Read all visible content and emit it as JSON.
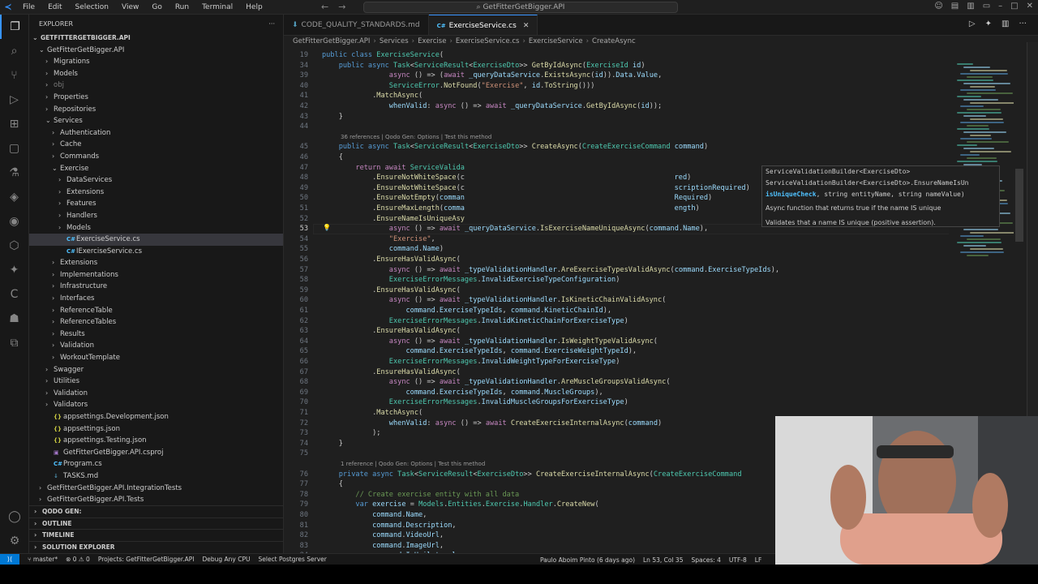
{
  "titlebar": {
    "menu": [
      "File",
      "Edit",
      "Selection",
      "View",
      "Go",
      "Run",
      "Terminal",
      "Help"
    ],
    "search": "GetFitterGetBigger.API"
  },
  "explorer": {
    "title": "EXPLORER",
    "root": "GETFITTERGETBIGGER.API",
    "tree": [
      {
        "label": "GetFitterGetBigger.API",
        "depth": 1,
        "type": "folder",
        "open": true
      },
      {
        "label": "Migrations",
        "depth": 2,
        "type": "folder"
      },
      {
        "label": "Models",
        "depth": 2,
        "type": "folder"
      },
      {
        "label": "obj",
        "depth": 2,
        "type": "folder",
        "dim": true
      },
      {
        "label": "Properties",
        "depth": 2,
        "type": "folder"
      },
      {
        "label": "Repositories",
        "depth": 2,
        "type": "folder"
      },
      {
        "label": "Services",
        "depth": 2,
        "type": "folder",
        "open": true
      },
      {
        "label": "Authentication",
        "depth": 3,
        "type": "folder"
      },
      {
        "label": "Cache",
        "depth": 3,
        "type": "folder"
      },
      {
        "label": "Commands",
        "depth": 3,
        "type": "folder"
      },
      {
        "label": "Exercise",
        "depth": 3,
        "type": "folder",
        "open": true
      },
      {
        "label": "DataServices",
        "depth": 4,
        "type": "folder"
      },
      {
        "label": "Extensions",
        "depth": 4,
        "type": "folder"
      },
      {
        "label": "Features",
        "depth": 4,
        "type": "folder"
      },
      {
        "label": "Handlers",
        "depth": 4,
        "type": "folder"
      },
      {
        "label": "Models",
        "depth": 4,
        "type": "folder"
      },
      {
        "label": "ExerciseService.cs",
        "depth": 4,
        "type": "cs",
        "selected": true
      },
      {
        "label": "IExerciseService.cs",
        "depth": 4,
        "type": "cs"
      },
      {
        "label": "Extensions",
        "depth": 3,
        "type": "folder"
      },
      {
        "label": "Implementations",
        "depth": 3,
        "type": "folder"
      },
      {
        "label": "Infrastructure",
        "depth": 3,
        "type": "folder"
      },
      {
        "label": "Interfaces",
        "depth": 3,
        "type": "folder"
      },
      {
        "label": "ReferenceTable",
        "depth": 3,
        "type": "folder"
      },
      {
        "label": "ReferenceTables",
        "depth": 3,
        "type": "folder"
      },
      {
        "label": "Results",
        "depth": 3,
        "type": "folder"
      },
      {
        "label": "Validation",
        "depth": 3,
        "type": "folder"
      },
      {
        "label": "WorkoutTemplate",
        "depth": 3,
        "type": "folder"
      },
      {
        "label": "Swagger",
        "depth": 2,
        "type": "folder"
      },
      {
        "label": "Utilities",
        "depth": 2,
        "type": "folder"
      },
      {
        "label": "Validation",
        "depth": 2,
        "type": "folder"
      },
      {
        "label": "Validators",
        "depth": 2,
        "type": "folder"
      },
      {
        "label": "appsettings.Development.json",
        "depth": 2,
        "type": "json"
      },
      {
        "label": "appsettings.json",
        "depth": 2,
        "type": "json"
      },
      {
        "label": "appsettings.Testing.json",
        "depth": 2,
        "type": "json"
      },
      {
        "label": "GetFitterGetBigger.API.csproj",
        "depth": 2,
        "type": "proj"
      },
      {
        "label": "Program.cs",
        "depth": 2,
        "type": "cs"
      },
      {
        "label": "TASKS.md",
        "depth": 2,
        "type": "md"
      },
      {
        "label": "GetFitterGetBigger.API.IntegrationTests",
        "depth": 1,
        "type": "folder"
      },
      {
        "label": "GetFitterGetBigger.API.Tests",
        "depth": 1,
        "type": "folder"
      }
    ],
    "sections": [
      "QODO GEN:",
      "OUTLINE",
      "TIMELINE",
      "SOLUTION EXPLORER"
    ]
  },
  "tabs": [
    {
      "label": "CODE_QUALITY_STANDARDS.md",
      "active": false
    },
    {
      "label": "ExerciseService.cs",
      "active": true
    }
  ],
  "breadcrumb": [
    "GetFitterGetBigger.API",
    "Services",
    "Exercise",
    "ExerciseService.cs",
    "ExerciseService",
    "CreateAsync"
  ],
  "hover": {
    "sig1": "ServiceValidationBuilder<ExerciseDto>",
    "sig2": "ServiceValidationBuilder<ExerciseDto>.EnsureNameIsUn",
    "sig3a": "isUniqueCheck",
    "sig3b": ", string entityName, string nameValue)",
    "desc1": "Async function that returns true if the name IS unique",
    "desc2": "Validates that a name IS unique (positive assertion)."
  },
  "status": {
    "branch": "master*",
    "problems": "⊗ 0 ⚠ 0",
    "project": "Projects: GetFitterGetBigger.API",
    "debug": "Debug Any CPU",
    "db": "Select Postgres Server",
    "blame": "Paulo Aboim Pinto (6 days ago)",
    "pos": "Ln 53, Col 35",
    "spaces": "Spaces: 4",
    "enc": "UTF-8",
    "eol": "LF"
  }
}
